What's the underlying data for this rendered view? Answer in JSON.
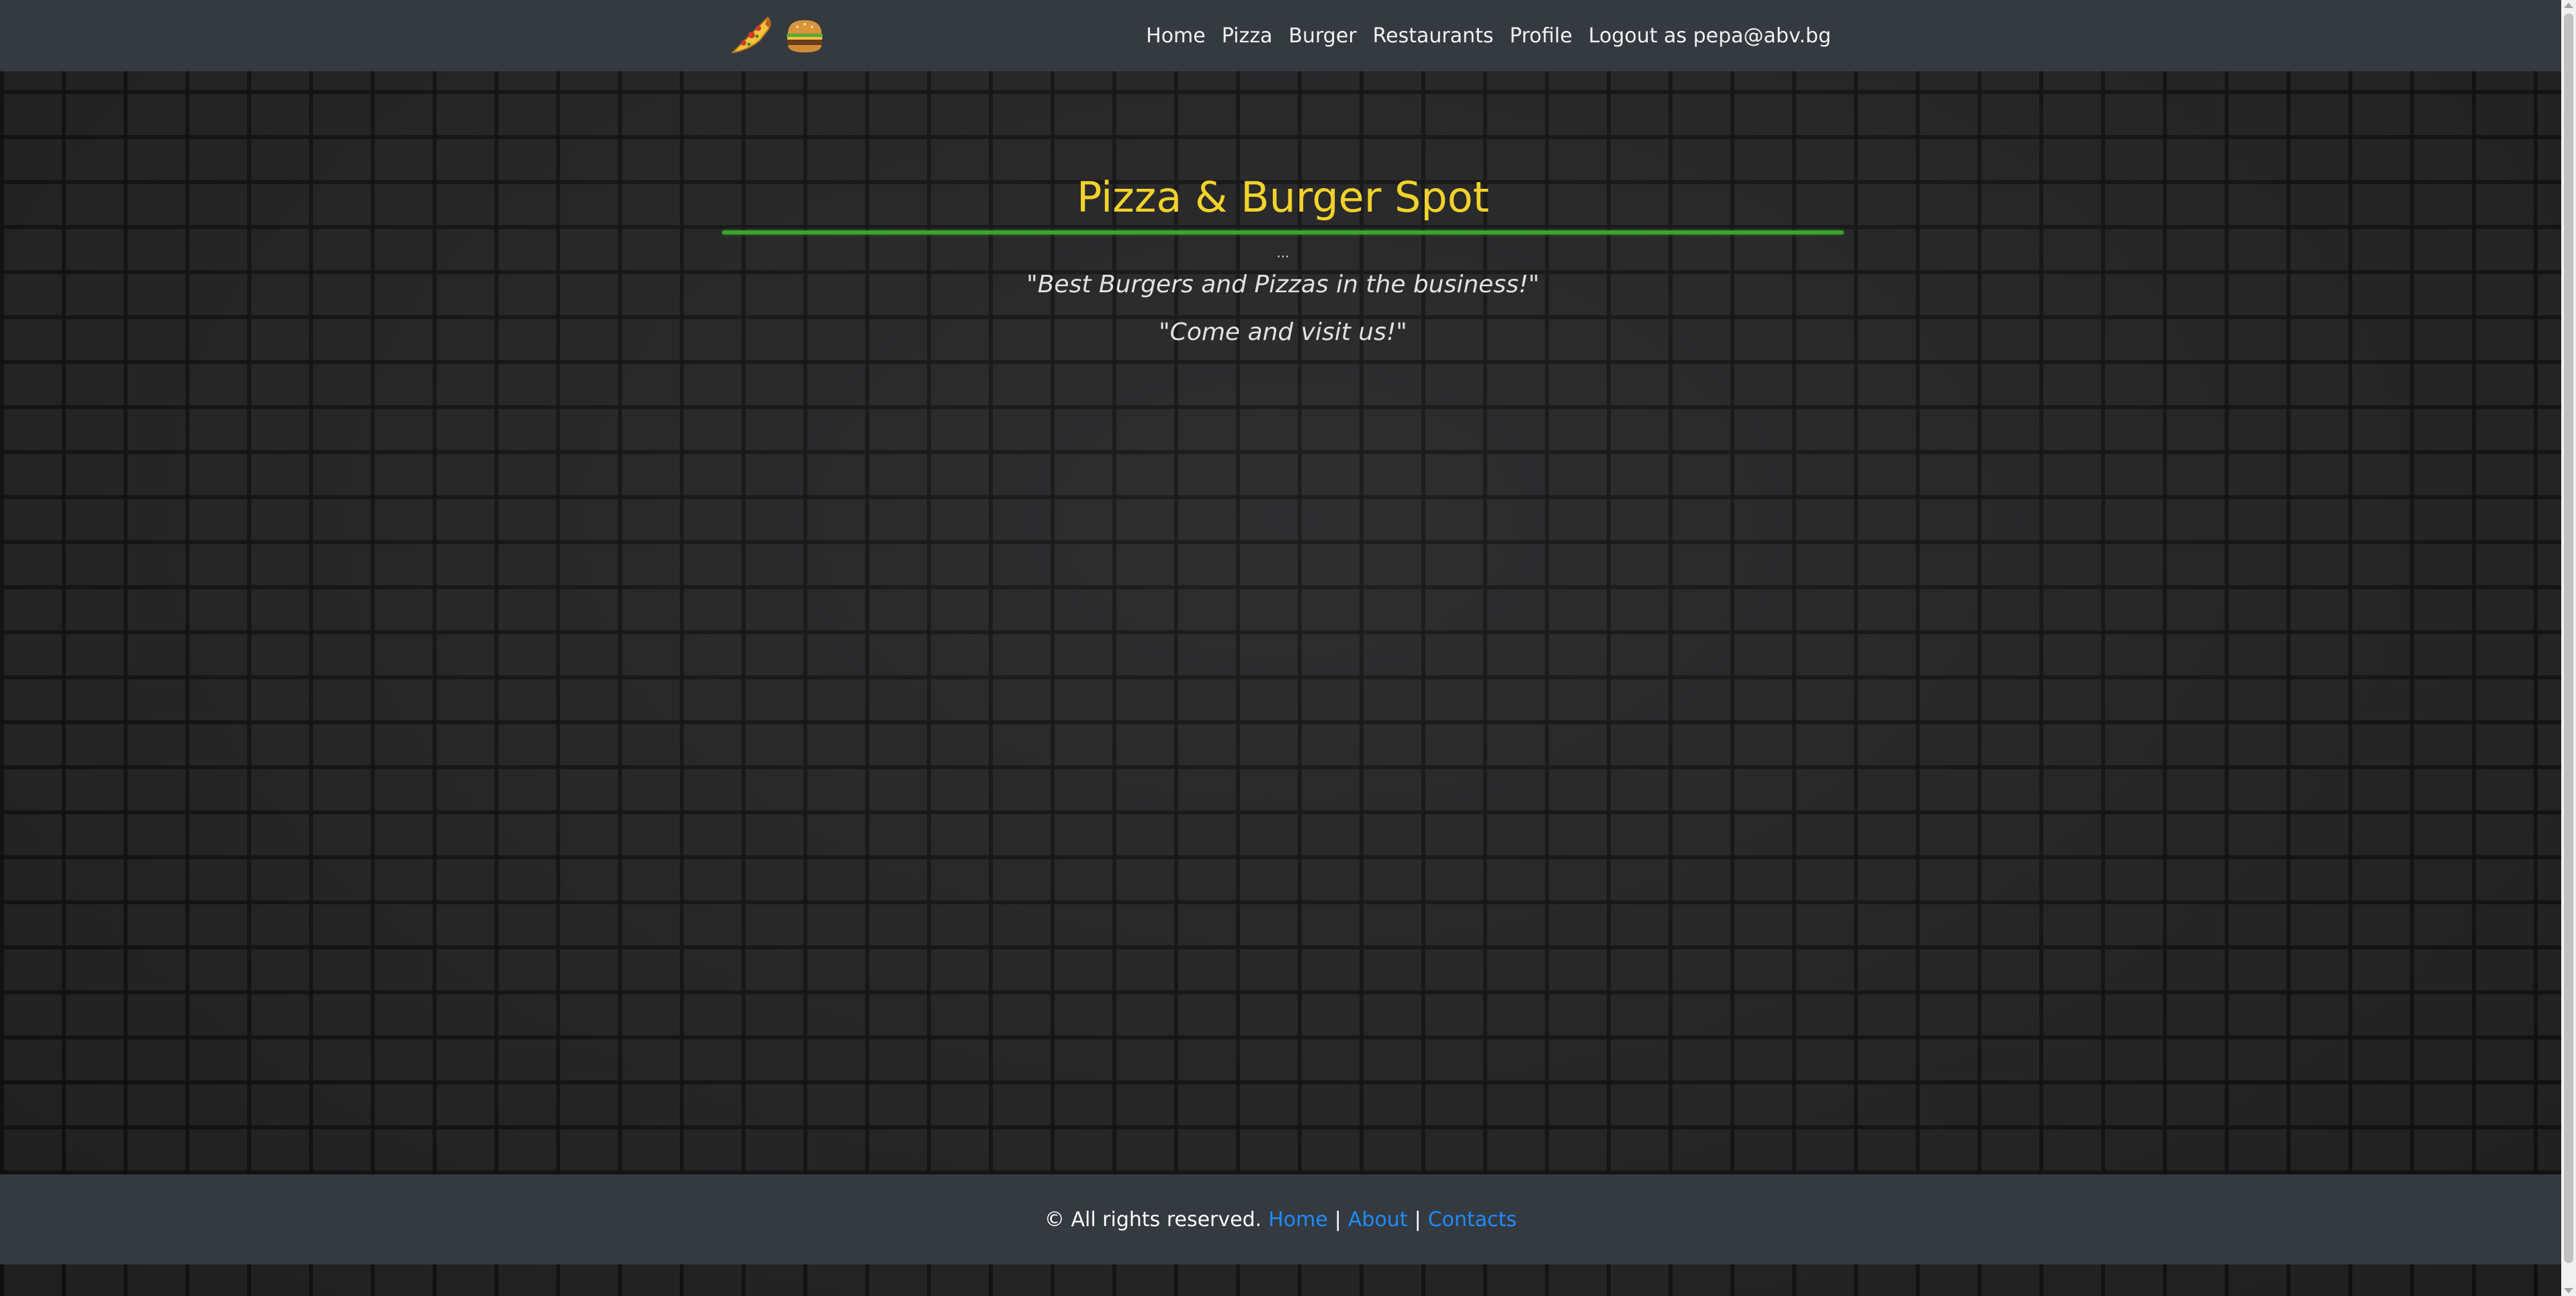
{
  "navbar": {
    "logo_icons": [
      "pizza-slice-icon",
      "burger-icon"
    ],
    "links": [
      {
        "label": "Home"
      },
      {
        "label": "Pizza"
      },
      {
        "label": "Burger"
      },
      {
        "label": "Restaurants"
      },
      {
        "label": "Profile"
      },
      {
        "label": "Logout as pepa@abv.bg"
      }
    ]
  },
  "hero": {
    "title": "Pizza & Burger Spot",
    "dots": "...",
    "tagline_1": "\"Best Burgers and Pizzas in the business!\"",
    "tagline_2": "\"Come and visit us!\""
  },
  "footer": {
    "copyright": "© All rights reserved.",
    "links": [
      {
        "label": "Home"
      },
      {
        "label": "About"
      },
      {
        "label": "Contacts"
      }
    ],
    "separator": "|"
  },
  "colors": {
    "navbar_bg": "#343a40",
    "title": "#f2d22b",
    "rule": "#3aa52a",
    "footer_link": "#1e8bff",
    "brick_bg": "#2a2a2b"
  }
}
